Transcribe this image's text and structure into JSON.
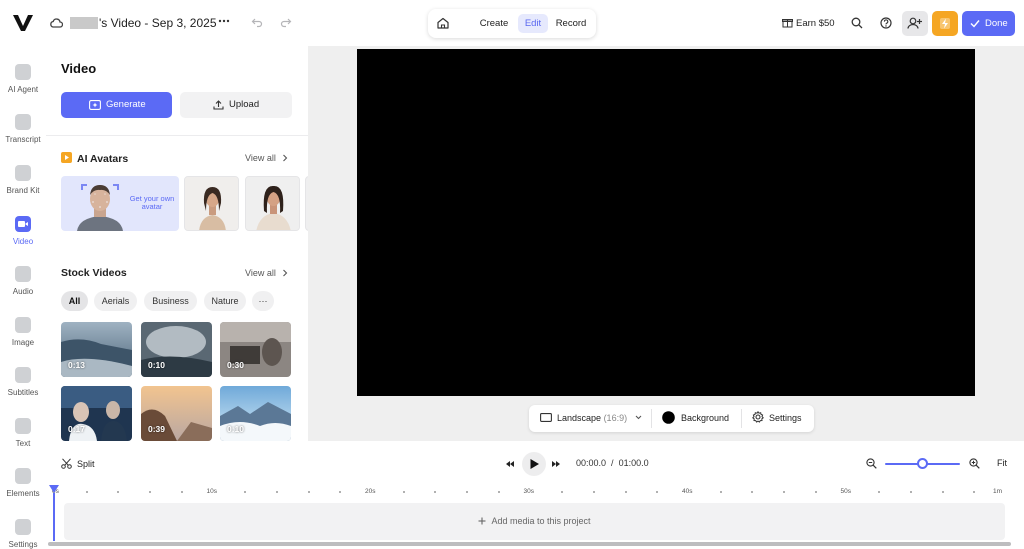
{
  "topbar": {
    "project_title": "'s Video - Sep 3, 2025",
    "modes": {
      "create": "Create",
      "edit": "Edit",
      "record": "Record"
    },
    "earn_label": "Earn $50",
    "done_label": "Done"
  },
  "rail": {
    "items": [
      {
        "label": "AI Agent"
      },
      {
        "label": "Transcript"
      },
      {
        "label": "Brand Kit"
      },
      {
        "label": "Video"
      },
      {
        "label": "Audio"
      },
      {
        "label": "Image"
      },
      {
        "label": "Subtitles"
      },
      {
        "label": "Text"
      },
      {
        "label": "Elements"
      },
      {
        "label": "Settings"
      }
    ]
  },
  "panel": {
    "title": "Video",
    "generate_label": "Generate",
    "upload_label": "Upload",
    "avatars": {
      "heading": "AI Avatars",
      "view_all": "View all",
      "cta": "Get your own avatar"
    },
    "stock": {
      "heading": "Stock Videos",
      "view_all": "View all",
      "chips": [
        "All",
        "Aerials",
        "Business",
        "Nature",
        "···"
      ],
      "videos": [
        {
          "duration": "0:13"
        },
        {
          "duration": "0:10"
        },
        {
          "duration": "0:30"
        },
        {
          "duration": "0:17"
        },
        {
          "duration": "0:39"
        },
        {
          "duration": "0:10"
        }
      ]
    }
  },
  "canvas_bar": {
    "aspect_label": "Landscape",
    "aspect_ratio": "(16:9)",
    "background_label": "Background",
    "settings_label": "Settings"
  },
  "timeline": {
    "split_label": "Split",
    "current_time": "00:00.0",
    "separator": "/",
    "total_time": "01:00.0",
    "fit_label": "Fit",
    "zoom_level": 0.5,
    "ruler_labels": [
      "0s",
      "10s",
      "20s",
      "30s",
      "40s",
      "50s",
      "1m"
    ],
    "add_media_label": "Add media to this project"
  },
  "colors": {
    "accent": "#5b6af5",
    "warning": "#f5a623"
  }
}
